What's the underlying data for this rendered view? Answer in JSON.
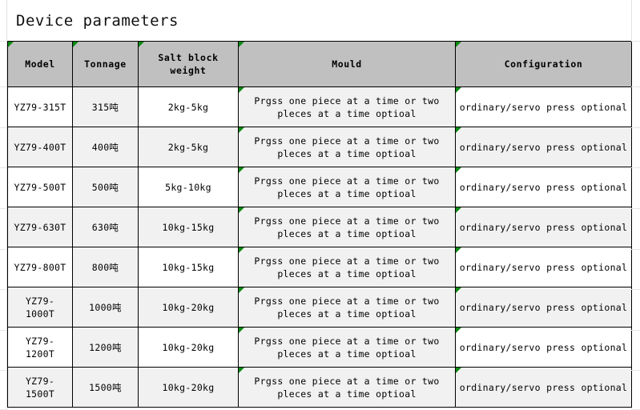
{
  "page": {
    "title": "Device parameters"
  },
  "table": {
    "columns": [
      {
        "key": "model",
        "label": "Model"
      },
      {
        "key": "tonnage",
        "label": "Tonnage"
      },
      {
        "key": "salt",
        "label": "Salt block weight"
      },
      {
        "key": "mould",
        "label": "Mould"
      },
      {
        "key": "config",
        "label": "Configuration"
      }
    ],
    "rows": [
      {
        "model": "YZ79-315T",
        "tonnage": "315吨",
        "salt": "2kg-5kg",
        "mould": "Prgss one piece at a time or two pleces at a time optioal",
        "config": "ordinary/servo press optional"
      },
      {
        "model": "YZ79-400T",
        "tonnage": "400吨",
        "salt": "2kg-5kg",
        "mould": "Prgss one piece at a time or two pleces at a time optioal",
        "config": "ordinary/servo press optional"
      },
      {
        "model": "YZ79-500T",
        "tonnage": "500吨",
        "salt": "5kg-10kg",
        "mould": "Prgss one piece at a time or two pleces at a time optioal",
        "config": "ordinary/servo press optional"
      },
      {
        "model": "YZ79-630T",
        "tonnage": "630吨",
        "salt": "10kg-15kg",
        "mould": "Prgss one piece at a time or two pleces at a time optioal",
        "config": "ordinary/servo press optional"
      },
      {
        "model": "YZ79-800T",
        "tonnage": "800吨",
        "salt": "10kg-15kg",
        "mould": "Prgss one piece at a time or two pleces at a time optioal",
        "config": "ordinary/servo press optional"
      },
      {
        "model": "YZ79-1000T",
        "tonnage": "1000吨",
        "salt": "10kg-20kg",
        "mould": "Prgss one piece at a time or two pleces at a time optioal",
        "config": "ordinary/servo press optional"
      },
      {
        "model": "YZ79-1200T",
        "tonnage": "1200吨",
        "salt": "10kg-20kg",
        "mould": "Prgss one piece at a time or two pleces at a time optioal",
        "config": "ordinary/servo press optional"
      },
      {
        "model": "YZ79-1500T",
        "tonnage": "1500吨",
        "salt": "10kg-20kg",
        "mould": "Prgss one piece at a time or two pleces at a time optioal",
        "config": "ordinary/servo press optional"
      }
    ]
  },
  "style": {
    "header_fill": "#c0c0c0",
    "cell_fill_shaded": "#f1f1f1",
    "cell_fill_plain": "#ffffff",
    "border_color": "#000000",
    "flag_color": "#0a8a12",
    "text_color": "#000000"
  }
}
